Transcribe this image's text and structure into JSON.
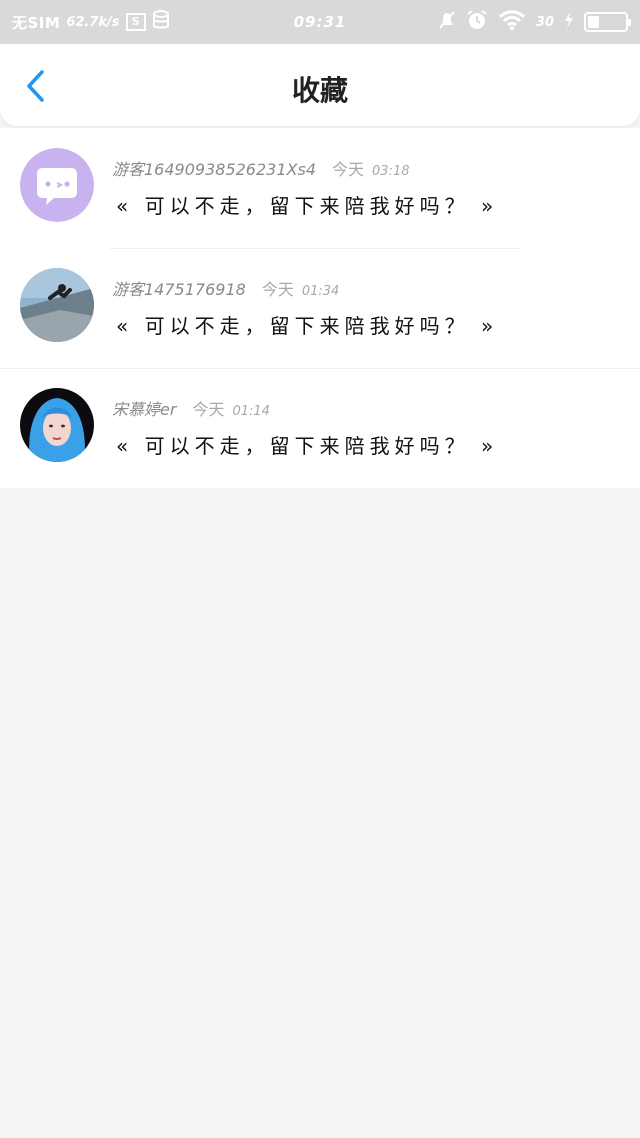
{
  "status_bar": {
    "carrier": "无SIM",
    "speed": "62.7k/s",
    "sim_box": "S",
    "time": "09:31",
    "battery_level": "30",
    "battery_fill": 0.3
  },
  "header": {
    "title": "收藏"
  },
  "favorites": [
    {
      "username": "游客16490938526231Xs4",
      "date_word": "今天",
      "time": "03:18",
      "quote": "« 可以不走，留下来陪我好吗？ »"
    },
    {
      "username": "游客1475176918",
      "date_word": "今天",
      "time": "01:34",
      "quote": "« 可以不走，留下来陪我好吗？ »"
    },
    {
      "username": "宋慕婷er",
      "date_word": "今天",
      "time": "01:14",
      "quote": "« 可以不走，留下来陪我好吗？ »"
    }
  ],
  "colors": {
    "accent": "#2196f3",
    "avatar1_bg": "#c8b2ef",
    "status_bar_bg": "#d9d9d9"
  },
  "icons": [
    "wifi-icon",
    "alarm-icon",
    "mute-icon",
    "battery-icon",
    "back-chevron-icon",
    "chat-bubble-icon"
  ]
}
